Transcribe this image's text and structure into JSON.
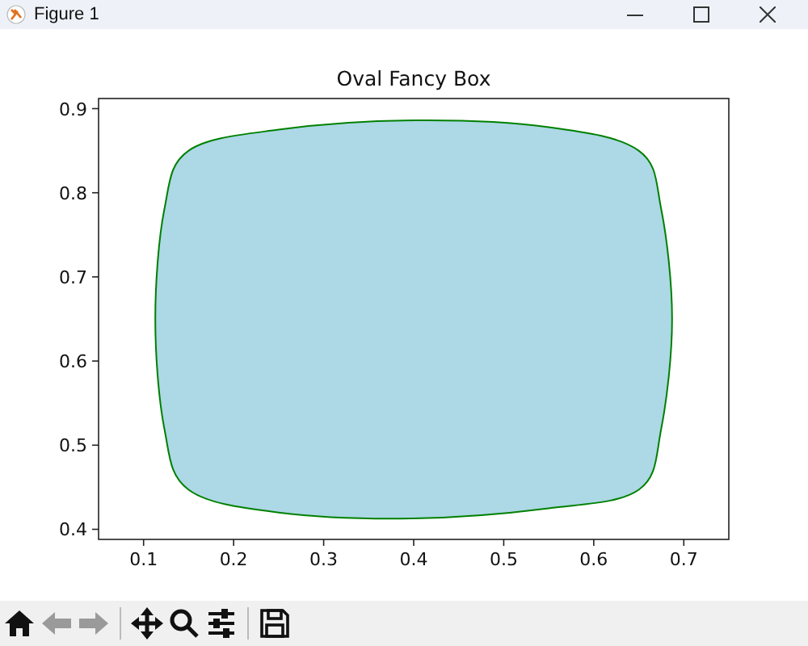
{
  "window": {
    "title": "Figure 1"
  },
  "figure": {
    "chart_data": {
      "type": "area",
      "title": "Oval Fancy Box",
      "xlim": [
        0.05,
        0.75
      ],
      "ylim": [
        0.388,
        0.912
      ],
      "xticks": [
        {
          "value": 0.1,
          "label": "0.1"
        },
        {
          "value": 0.2,
          "label": "0.2"
        },
        {
          "value": 0.3,
          "label": "0.3"
        },
        {
          "value": 0.4,
          "label": "0.4"
        },
        {
          "value": 0.5,
          "label": "0.5"
        },
        {
          "value": 0.6,
          "label": "0.6"
        },
        {
          "value": 0.7,
          "label": "0.7"
        }
      ],
      "yticks": [
        {
          "value": 0.4,
          "label": "0.4"
        },
        {
          "value": 0.5,
          "label": "0.5"
        },
        {
          "value": 0.6,
          "label": "0.6"
        },
        {
          "value": 0.7,
          "label": "0.7"
        },
        {
          "value": 0.8,
          "label": "0.8"
        },
        {
          "value": 0.9,
          "label": "0.9"
        }
      ],
      "x": [
        0.4,
        0.55,
        0.65,
        0.675,
        0.687,
        0.675,
        0.65,
        0.55,
        0.4,
        0.25,
        0.15,
        0.123,
        0.113,
        0.123,
        0.15,
        0.25
      ],
      "series": [
        {
          "color": "#008000",
          "values": [
            0.886,
            0.878,
            0.85,
            0.78,
            0.65,
            0.52,
            0.447,
            0.425,
            0.413,
            0.42,
            0.447,
            0.52,
            0.65,
            0.78,
            0.85,
            0.875
          ]
        }
      ]
    }
  },
  "toolbar": [
    {
      "kind": "home",
      "disabled": false
    },
    {
      "kind": "back",
      "disabled": true
    },
    {
      "kind": "forward",
      "disabled": true
    },
    {
      "kind": "separator"
    },
    {
      "kind": "move",
      "disabled": false
    },
    {
      "kind": "zoom",
      "disabled": false
    },
    {
      "kind": "configure",
      "disabled": false
    },
    {
      "kind": "separator"
    },
    {
      "kind": "save",
      "disabled": false
    }
  ]
}
